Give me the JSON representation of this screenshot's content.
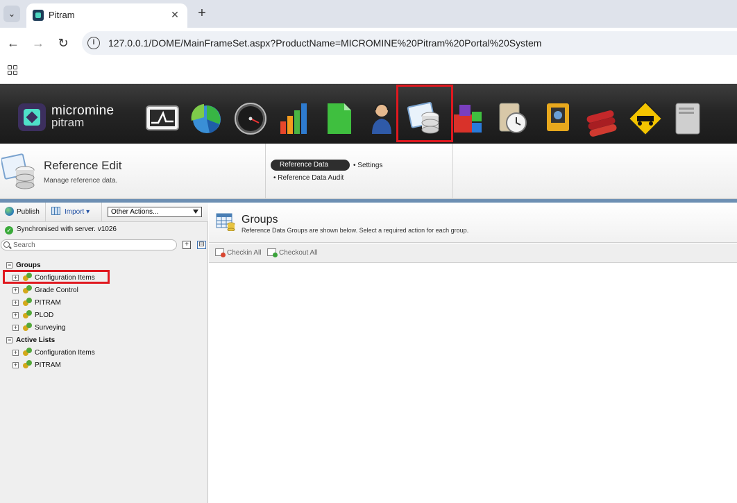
{
  "browser": {
    "tab_title": "Pitram",
    "url": "127.0.0.1/DOME/MainFrameSet.aspx?ProductName=MICROMINE%20Pitram%20Portal%20System",
    "back_icon": "←",
    "forward_icon": "→",
    "reload_icon": "↻",
    "new_tab_icon": "+",
    "close_icon": "✕",
    "tab_menu_icon": "⌄"
  },
  "app_header": {
    "brand_line1": "micromine",
    "brand_line2": "pitram",
    "modules": [
      "monitor-icon",
      "pie-chart-icon",
      "gauge-icon",
      "bar-chart-icon",
      "document-icon",
      "operator-headset-icon",
      "reference-data-icon",
      "blocks-icon",
      "clock-clipboard-icon",
      "survey-instrument-icon",
      "explosives-icon",
      "warning-truck-icon",
      "server-icon"
    ],
    "selected_module": "reference-data-icon"
  },
  "page_header": {
    "title": "Reference Edit",
    "subtitle": "Manage reference data.",
    "active_link": "Reference Data",
    "links": [
      "• Settings",
      "• Reference Data Audit"
    ]
  },
  "left_panel": {
    "publish_label": "Publish",
    "import_label": "Import ▾",
    "other_actions": "Other Actions...",
    "sync_status": "Synchronised with server. v1026",
    "search_placeholder": "Search",
    "tree": {
      "groups_label": "Groups",
      "groups": [
        "Configuration Items",
        "Grade Control",
        "PITRAM",
        "PLOD",
        "Surveying"
      ],
      "active_lists_label": "Active Lists",
      "active_lists": [
        "Configuration Items",
        "PITRAM"
      ]
    },
    "expander_collapsed": "+",
    "expander_expanded": "−"
  },
  "main": {
    "title": "Groups",
    "description": "Reference Data Groups are shown below. Select a required action for each group.",
    "checkin_label": "Checkin All",
    "checkout_label": "Checkout All"
  },
  "colors": {
    "highlight": "#e0181f",
    "header_bg": "#262626",
    "divider_blue": "#6d8fb3",
    "brand_accent": "#4fe0c8"
  }
}
